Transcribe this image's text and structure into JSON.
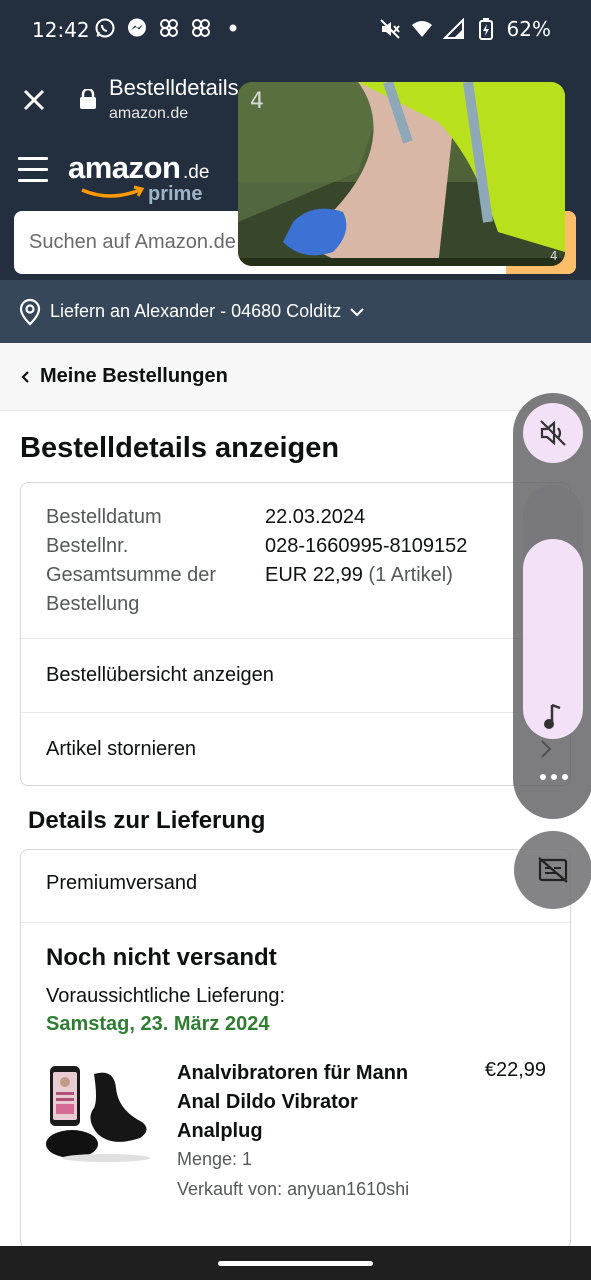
{
  "status_bar": {
    "time": "12:42",
    "battery": "62%",
    "icons_left": [
      "whatsapp-icon",
      "messenger-icon",
      "pinwheel-icon",
      "pinwheel-icon",
      "dot-icon"
    ],
    "icons_right": [
      "mute-icon",
      "wifi-icon",
      "signal-icon",
      "battery-icon"
    ]
  },
  "browser": {
    "title": "Bestelldetails",
    "domain": "amazon.de"
  },
  "header": {
    "logo_main": "amazon",
    "logo_tld": ".de",
    "logo_sub": "prime",
    "search_placeholder": "Suchen auf Amazon.de",
    "deliver_to": "Liefern an Alexander - 04680 Colditz"
  },
  "breadcrumb": {
    "label": "Meine Bestellungen"
  },
  "page": {
    "heading": "Bestelldetails anzeigen"
  },
  "order": {
    "date_label": "Bestelldatum",
    "date_value": "22.03.2024",
    "number_label": "Bestellnr.",
    "number_value": "028-1660995-8109152",
    "total_label": "Gesamtsumme der Bestellung",
    "total_value": "EUR 22,99",
    "total_items": "(1 Artikel)",
    "summary_link": "Bestellübersicht anzeigen",
    "cancel_link": "Artikel stornieren"
  },
  "delivery": {
    "heading": "Details zur Lieferung",
    "method": "Premiumversand",
    "status": "Noch nicht versandt",
    "estimate_label": "Voraussichtliche Lieferung:",
    "estimate_date": "Samstag, 23. März 2024",
    "product": {
      "title": "Analvibratoren für Mann Anal Dildo Vibrator Analplug",
      "price": "€22,99",
      "quantity": "Menge: 1",
      "seller": "Verkauft von: anyuan1610shi"
    }
  },
  "colors": {
    "header_bg": "#232f3e",
    "deliver_bg": "#37475a",
    "search_button": "#febd69",
    "delivery_date": "#2f7d32",
    "control_pill": "#f3e2f7"
  }
}
